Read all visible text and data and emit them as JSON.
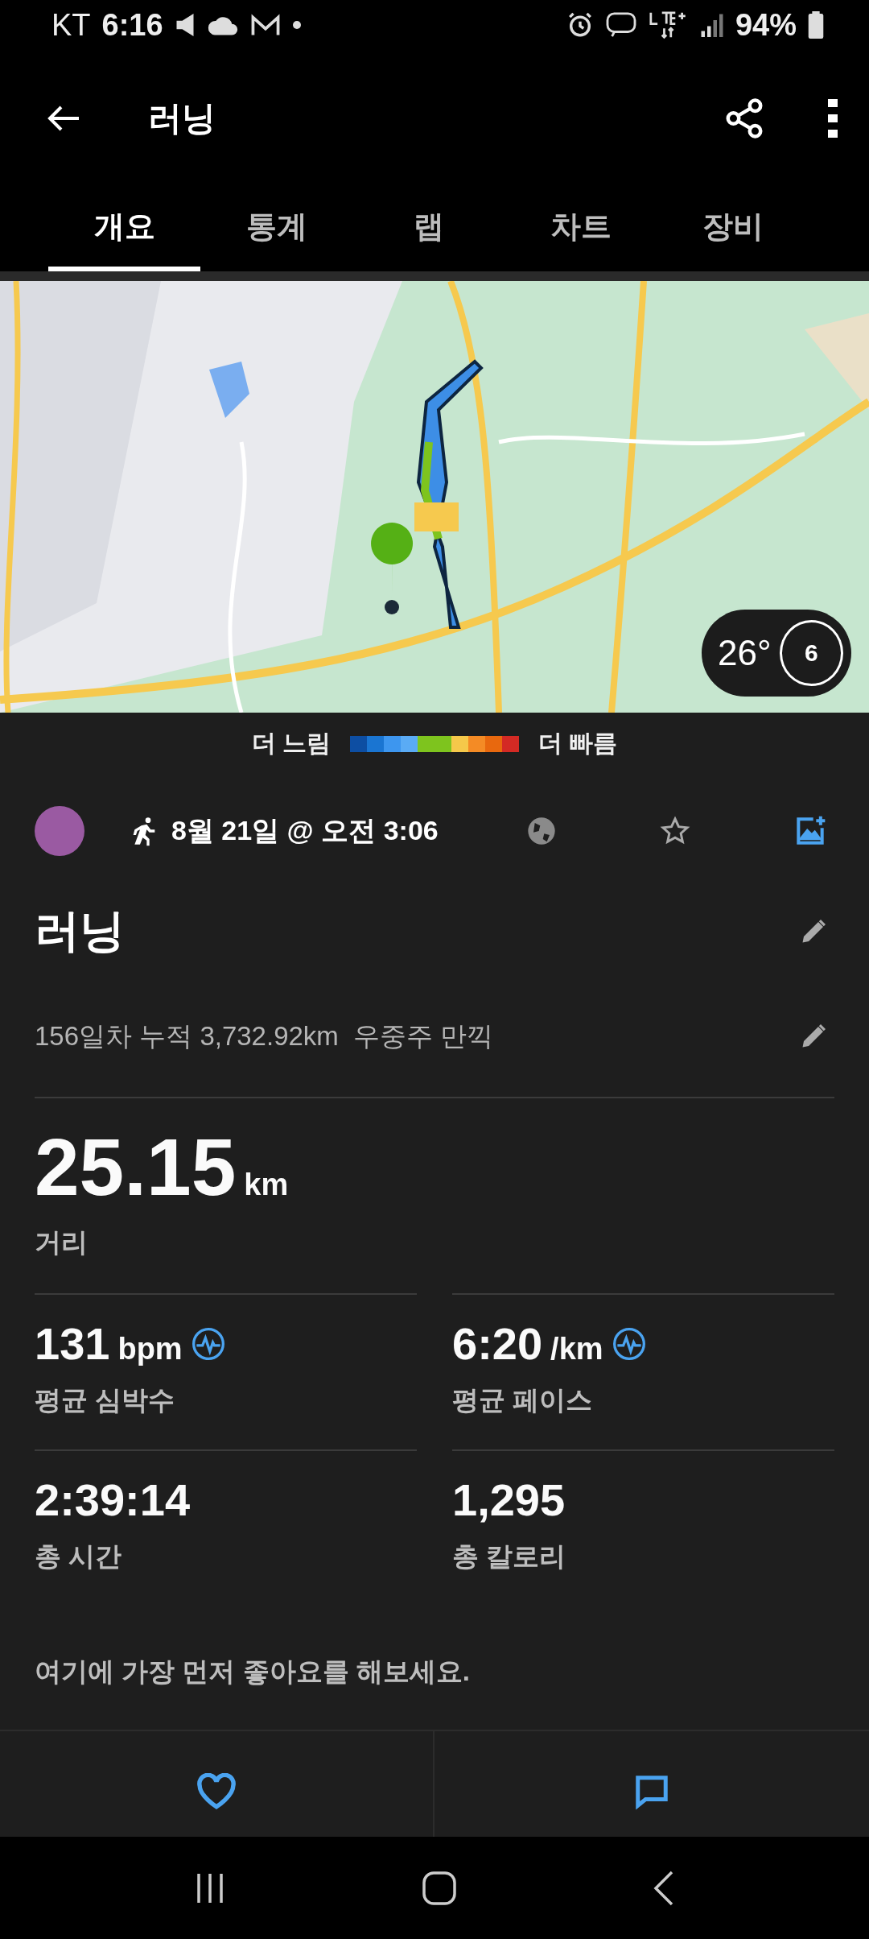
{
  "status_bar": {
    "carrier": "KT",
    "time": "6:16",
    "battery": "94%"
  },
  "app_bar": {
    "title": "러닝"
  },
  "tabs": [
    {
      "label": "개요",
      "selected": true
    },
    {
      "label": "통계",
      "selected": false
    },
    {
      "label": "랩",
      "selected": false
    },
    {
      "label": "차트",
      "selected": false
    },
    {
      "label": "장비",
      "selected": false
    }
  ],
  "map": {
    "kind": "picture",
    "weather": {
      "temperature": "26°",
      "gauge": "6"
    }
  },
  "legend": {
    "slow": "더 느림",
    "fast": "더 빠름"
  },
  "activity": {
    "date": "8월 21일 @ 오전 3:06"
  },
  "title": "러닝",
  "note": "156일차 누적 3,732.92km  우중주 만끽",
  "distance": {
    "value": "25.15",
    "unit": "km",
    "label": "거리"
  },
  "stats": [
    {
      "value": "131",
      "unit": "bpm",
      "label": "평균 심박수",
      "kind": "heart-rate"
    },
    {
      "value": "6:20",
      "unit": "/km",
      "label": "평균 페이스",
      "kind": "heart-rate"
    },
    {
      "value": "2:39:14",
      "label": "총 시간",
      "kind": "plain"
    },
    {
      "value": "1,295",
      "label": "총 칼로리",
      "kind": "plain"
    }
  ],
  "like_prompt": "여기에 가장 먼저 좋아요를 해보세요."
}
